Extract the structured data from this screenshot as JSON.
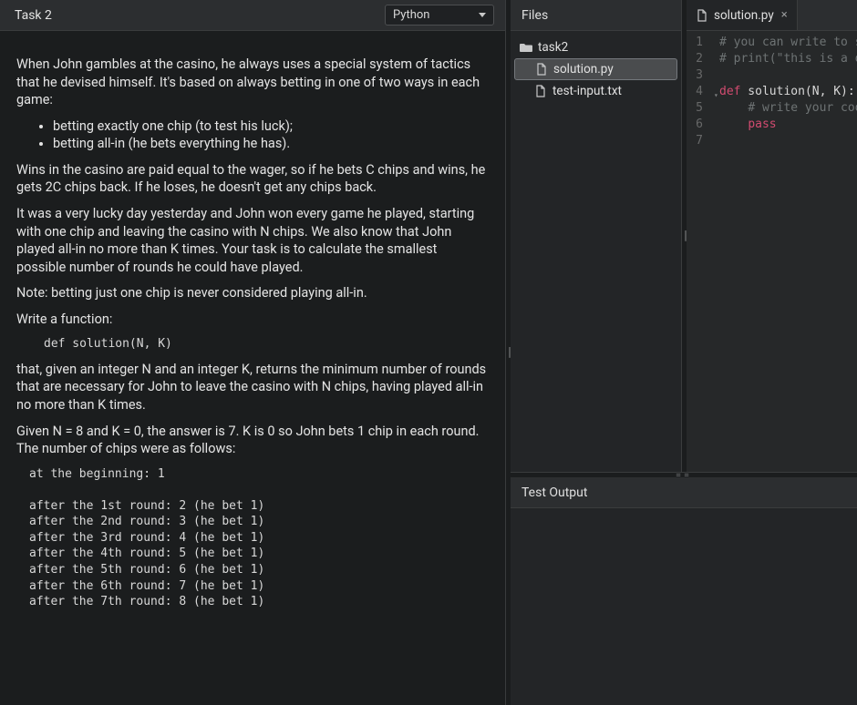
{
  "header": {
    "task_title": "Task 2",
    "language": "Python"
  },
  "problem": {
    "p1": "When John gambles at the casino, he always uses a special system of tactics that he devised himself. It's based on always betting in one of two ways in each game:",
    "bullets": [
      "betting exactly one chip (to test his luck);",
      "betting all-in (he bets everything he has)."
    ],
    "p2": "Wins in the casino are paid equal to the wager, so if he bets C chips and wins, he gets 2C chips back. If he loses, he doesn't get any chips back.",
    "p3": "It was a very lucky day yesterday and John won every game he played, starting with one chip and leaving the casino with N chips. We also know that John played all-in no more than K times. Your task is to calculate the smallest possible number of rounds he could have played.",
    "p4": "Note: betting just one chip is never considered playing all-in.",
    "p5": "Write a function:",
    "sig": "def solution(N, K)",
    "p6": "that, given an integer N and an integer K, returns the minimum number of rounds that are necessary for John to leave the casino with N chips, having played all-in no more than K times.",
    "p7": "Given N = 8 and K = 0, the answer is 7. K is 0 so John bets 1 chip in each round. The number of chips were as follows:",
    "example": "at the beginning: 1\n\nafter the 1st round: 2 (he bet 1)\nafter the 2nd round: 3 (he bet 1)\nafter the 3rd round: 4 (he bet 1)\nafter the 4th round: 5 (he bet 1)\nafter the 5th round: 6 (he bet 1)\nafter the 6th round: 7 (he bet 1)\nafter the 7th round: 8 (he bet 1)"
  },
  "files": {
    "header": "Files",
    "folder": "task2",
    "items": [
      "solution.py",
      "test-input.txt"
    ]
  },
  "editor": {
    "tab_label": "solution.py",
    "lines": [
      {
        "n": 1,
        "segments": [
          [
            "comment",
            "# you can write to sto"
          ]
        ]
      },
      {
        "n": 2,
        "segments": [
          [
            "comment",
            "# print(\"this is a deb"
          ]
        ]
      },
      {
        "n": 3,
        "segments": [
          [
            "plain",
            ""
          ]
        ]
      },
      {
        "n": 4,
        "fold": true,
        "segments": [
          [
            "keyword",
            "def"
          ],
          [
            "plain",
            " solution(N, K):"
          ]
        ]
      },
      {
        "n": 5,
        "segments": [
          [
            "plain",
            "    "
          ],
          [
            "comment",
            "# write your code"
          ]
        ]
      },
      {
        "n": 6,
        "segments": [
          [
            "plain",
            "    "
          ],
          [
            "keyword",
            "pass"
          ]
        ]
      },
      {
        "n": 7,
        "segments": [
          [
            "plain",
            ""
          ]
        ]
      }
    ]
  },
  "output": {
    "header": "Test Output",
    "body": ""
  }
}
